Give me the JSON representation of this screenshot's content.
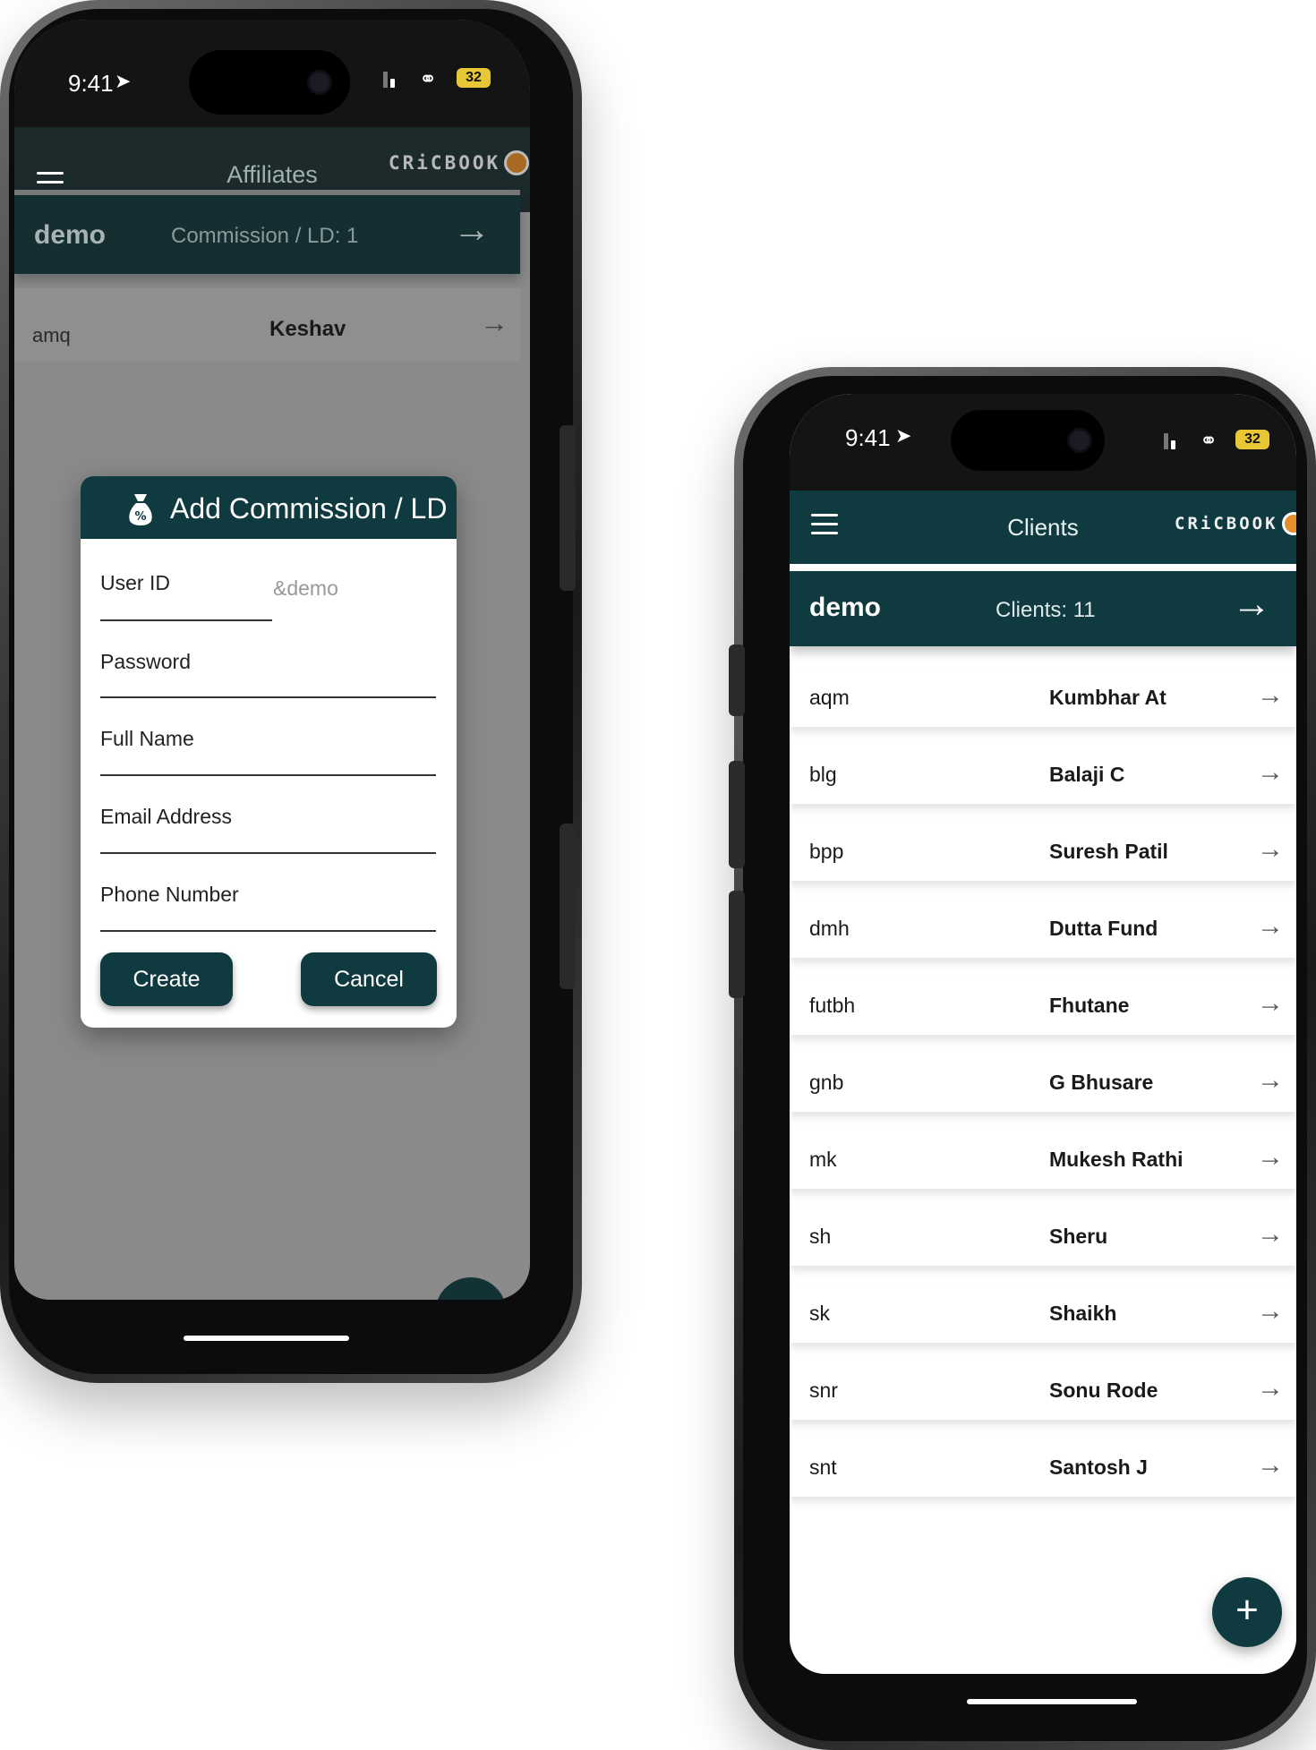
{
  "status_bar": {
    "time": "9:41",
    "battery": "32"
  },
  "brand": {
    "logo_text": "CRiCBOOK"
  },
  "left_screen": {
    "title": "Affiliates",
    "header": {
      "user": "demo",
      "count_text": "Commission / LD: 1"
    },
    "list": [
      {
        "id": "amq",
        "name": "Keshav"
      }
    ],
    "dialog": {
      "title": "Add Commission / LD",
      "fields": {
        "user_id": {
          "label": "User ID",
          "hint": "&demo"
        },
        "password": {
          "label": "Password"
        },
        "full_name": {
          "label": "Full Name"
        },
        "email": {
          "label": "Email Address"
        },
        "phone": {
          "label": "Phone Number"
        }
      },
      "create_label": "Create",
      "cancel_label": "Cancel"
    }
  },
  "right_screen": {
    "title": "Clients",
    "header": {
      "user": "demo",
      "count_text": "Clients: 11"
    },
    "clients": [
      {
        "id": "aqm",
        "name": "Kumbhar At"
      },
      {
        "id": "blg",
        "name": "Balaji C"
      },
      {
        "id": "bpp",
        "name": "Suresh Patil"
      },
      {
        "id": "dmh",
        "name": "Dutta Fund"
      },
      {
        "id": "futbh",
        "name": "Fhutane"
      },
      {
        "id": "gnb",
        "name": "G Bhusare"
      },
      {
        "id": "mk",
        "name": "Mukesh Rathi"
      },
      {
        "id": "sh",
        "name": "Sheru"
      },
      {
        "id": "sk",
        "name": "Shaikh"
      },
      {
        "id": "snr",
        "name": "Sonu Rode"
      },
      {
        "id": "snt",
        "name": "Santosh J"
      }
    ],
    "fab_label": "+"
  },
  "icons": {
    "menu": "hamburger-icon",
    "arrow": "arrow-right-icon",
    "dialog": "money-bag-icon",
    "add": "plus-icon"
  },
  "colors": {
    "primary": "#0f3a3f",
    "accent": "#e48f2d",
    "battery": "#e8c736"
  }
}
